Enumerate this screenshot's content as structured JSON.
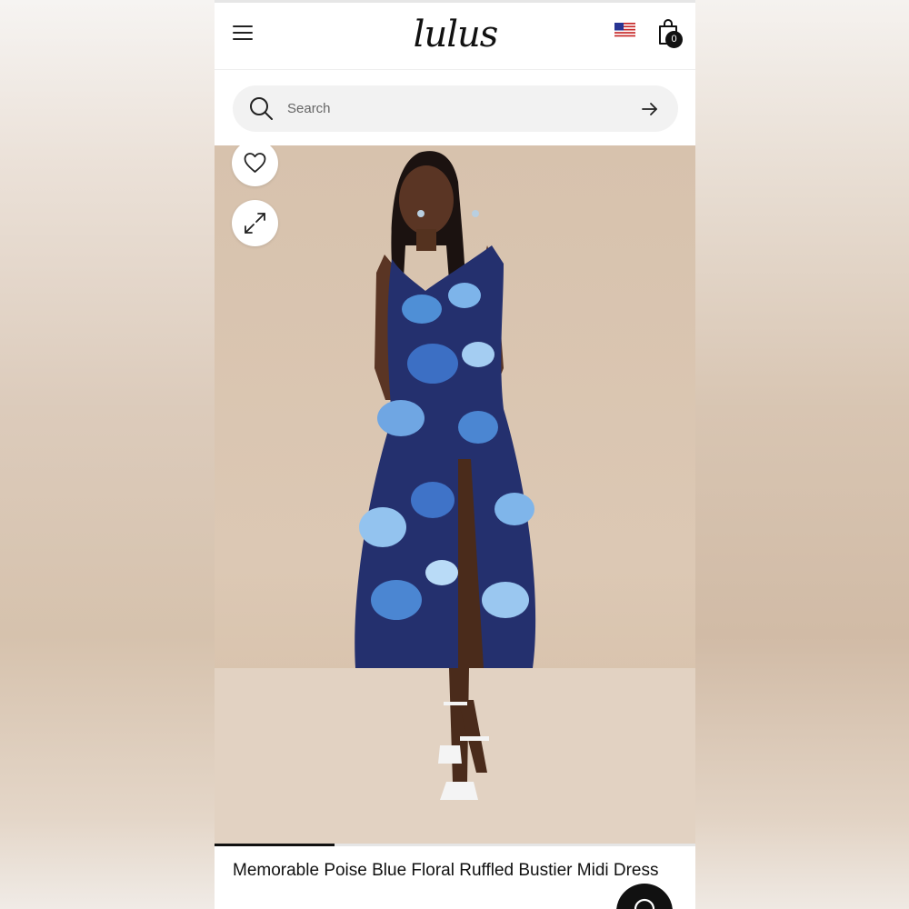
{
  "header": {
    "logo_text": "lulus",
    "cart_count": "0",
    "menu_icon": "hamburger-menu-icon",
    "region_icon": "us-flag-icon",
    "cart_icon": "shopping-bag-icon"
  },
  "search": {
    "placeholder": "Search",
    "value": "",
    "icon": "search-icon",
    "submit_icon": "arrow-right-icon"
  },
  "gallery": {
    "wishlist_icon": "heart-icon",
    "expand_icon": "expand-icon",
    "progress": 0.25
  },
  "product": {
    "title": "Memorable Poise Blue Floral Ruffled Bustier Midi Dress"
  },
  "chat": {
    "icon": "chat-icon"
  },
  "colors": {
    "accent": "#111111",
    "search_bg": "#f2f2f2",
    "photo_bg": "#d7c2ad"
  }
}
